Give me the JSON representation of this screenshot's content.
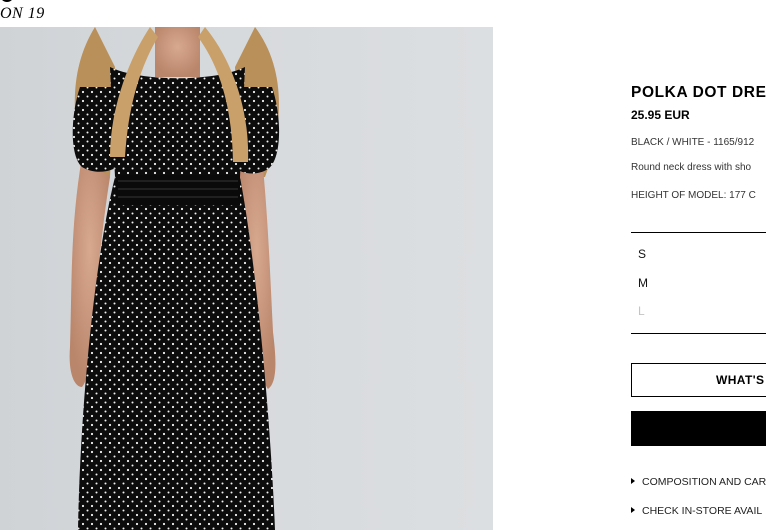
{
  "brand": {
    "fragment": "ON 19"
  },
  "product": {
    "title": "POLKA DOT DRE",
    "price": "25.95 EUR",
    "color_ref": "BLACK / WHITE - 1165/912",
    "description": "Round neck dress with sho",
    "model_height": "HEIGHT OF MODEL: 177 C"
  },
  "sizes": [
    {
      "label": "S",
      "available": true
    },
    {
      "label": "M",
      "available": true
    },
    {
      "label": "L",
      "available": false
    }
  ],
  "buttons": {
    "whats_my_size": "WHAT'S",
    "add_to_basket": ""
  },
  "links": {
    "composition": "COMPOSITION AND CAR",
    "store_availability": "CHECK IN-STORE AVAIL"
  },
  "colors": {
    "dress": "#0c0c0c",
    "dots": "#f2f2f2",
    "background": "#d6d9dc",
    "unavailable_size": "#c4c4c4"
  }
}
